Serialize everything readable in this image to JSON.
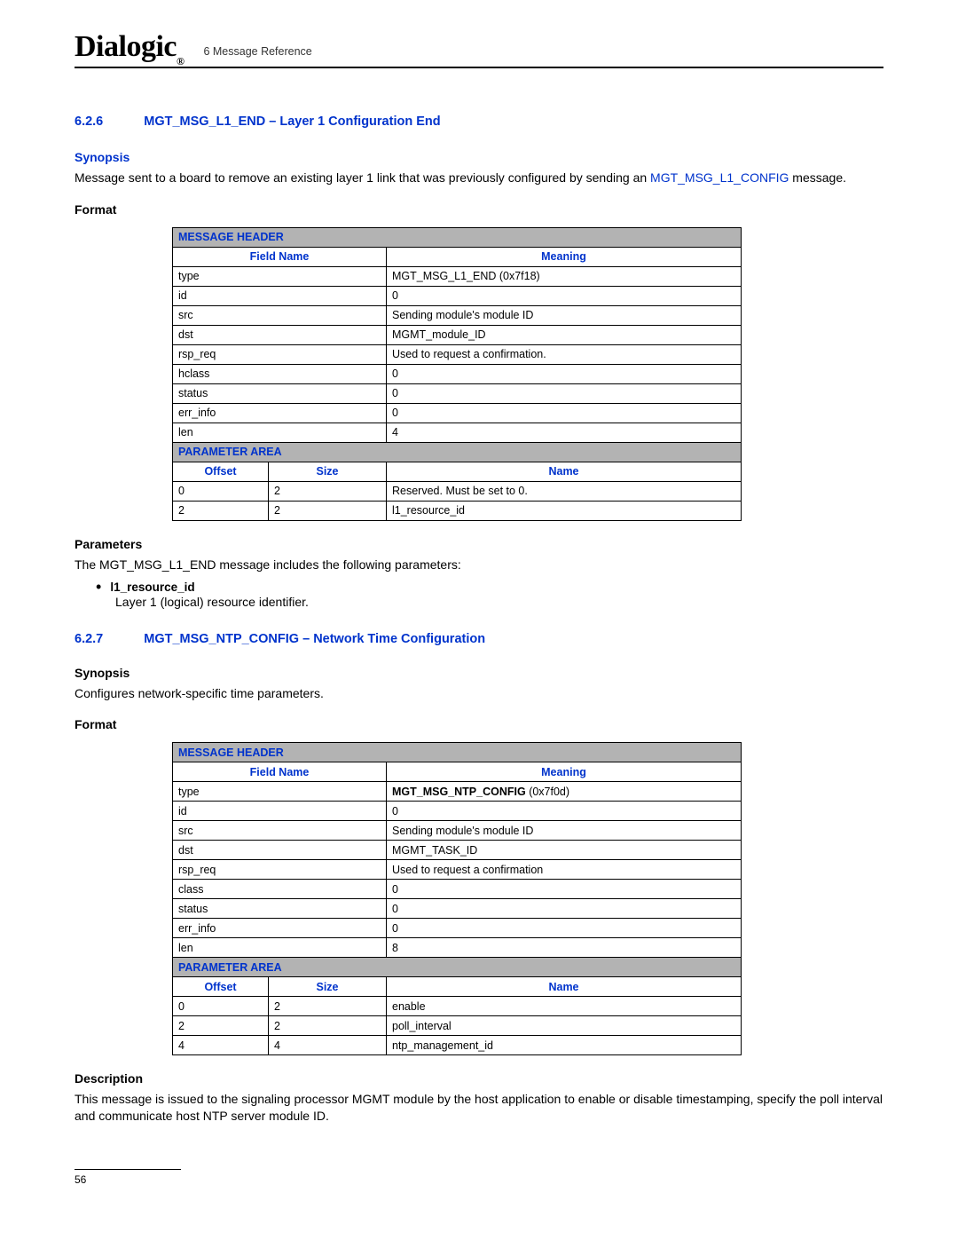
{
  "header": {
    "logo_text": "Dialogic",
    "chapter_ref": "6 Message Reference"
  },
  "section1": {
    "num": "6.2.6",
    "title": "MGT_MSG_L1_END – Layer 1 Configuration End",
    "synopsis_label": "Synopsis",
    "synopsis_prefix": "Message sent to a board to remove an existing layer 1 link that was previously configured by sending an ",
    "synopsis_link": "MGT_MSG_L1_CONFIG",
    "synopsis_suffix": " message.",
    "format_label": "Format",
    "table": {
      "msg_header_label": "MESSAGE HEADER",
      "field_name_label": "Field Name",
      "meaning_label": "Meaning",
      "rows": [
        {
          "f": "type",
          "m": "MGT_MSG_L1_END (0x7f18)"
        },
        {
          "f": "id",
          "m": "0"
        },
        {
          "f": "src",
          "m": "Sending module's module ID"
        },
        {
          "f": "dst",
          "m": "MGMT_module_ID"
        },
        {
          "f": "rsp_req",
          "m": "Used to request a confirmation."
        },
        {
          "f": "hclass",
          "m": "0"
        },
        {
          "f": "status",
          "m": "0"
        },
        {
          "f": "err_info",
          "m": "0"
        },
        {
          "f": "len",
          "m": "4"
        }
      ],
      "param_area_label": "PARAMETER AREA",
      "offset_label": "Offset",
      "size_label": "Size",
      "name_label": "Name",
      "param_rows": [
        {
          "o": "0",
          "s": "2",
          "n": "Reserved. Must be set to 0."
        },
        {
          "o": "2",
          "s": "2",
          "n": "l1_resource_id"
        }
      ]
    },
    "params_label": "Parameters",
    "params_intro": "The MGT_MSG_L1_END message includes the following parameters:",
    "bullet_label": "l1_resource_id",
    "bullet_desc": "Layer 1 (logical) resource identifier."
  },
  "section2": {
    "num": "6.2.7",
    "title": "MGT_MSG_NTP_CONFIG – Network Time Configuration",
    "synopsis_label": "Synopsis",
    "synopsis_text": "Configures network-specific time parameters.",
    "format_label": "Format",
    "table": {
      "msg_header_label": "MESSAGE HEADER",
      "field_name_label": "Field Name",
      "meaning_label": "Meaning",
      "rows": [
        {
          "f": "type",
          "m_strong": "MGT_MSG_NTP_CONFIG",
          "m_rest": " (0x7f0d)"
        },
        {
          "f": "id",
          "m": "0"
        },
        {
          "f": "src",
          "m": "Sending module's module ID"
        },
        {
          "f": "dst",
          "m": "MGMT_TASK_ID"
        },
        {
          "f": "rsp_req",
          "m": "Used to request a confirmation"
        },
        {
          "f": "class",
          "m": "0"
        },
        {
          "f": "status",
          "m": "0"
        },
        {
          "f": "err_info",
          "m": "0"
        },
        {
          "f": "len",
          "m": "8"
        }
      ],
      "param_area_label": "PARAMETER AREA",
      "offset_label": "Offset",
      "size_label": "Size",
      "name_label": "Name",
      "param_rows": [
        {
          "o": "0",
          "s": "2",
          "n": "enable"
        },
        {
          "o": "2",
          "s": "2",
          "n": "poll_interval"
        },
        {
          "o": "4",
          "s": "4",
          "n": "ntp_management_id"
        }
      ]
    },
    "desc_label": "Description",
    "desc_text": "This message is issued to the signaling processor MGMT module by the host application to enable or disable timestamping, specify the poll interval and communicate host NTP server module ID."
  },
  "page_number": "56"
}
